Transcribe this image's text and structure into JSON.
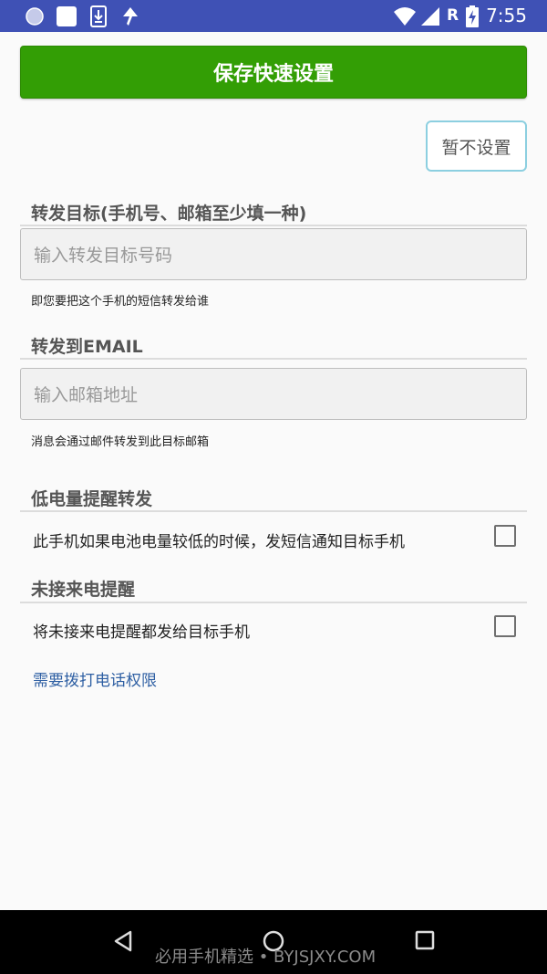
{
  "status_bar": {
    "time": "7:55",
    "network_letter": "R",
    "icons": [
      "circle-icon",
      "square-icon",
      "download-icon",
      "sync-icon",
      "wifi-icon",
      "signal-icon",
      "battery-charging-icon"
    ]
  },
  "actions": {
    "save_label": "保存快速设置",
    "skip_label": "暂不设置"
  },
  "forward_target": {
    "title": "转发目标(手机号、邮箱至少填一种)",
    "phone_placeholder": "输入转发目标号码",
    "phone_value": "",
    "phone_hint": "即您要把这个手机的短信转发给谁"
  },
  "email": {
    "title": "转发到EMAIL",
    "placeholder": "输入邮箱地址",
    "value": "",
    "hint": "消息会通过邮件转发到此目标邮箱"
  },
  "low_battery": {
    "title": "低电量提醒转发",
    "option_label": "此手机如果电池电量较低的时候，发短信通知目标手机",
    "checked": false
  },
  "missed_call": {
    "title": "未接来电提醒",
    "option_label": "将未接来电提醒都发给目标手机",
    "checked": false,
    "permission_link": "需要拨打电话权限"
  },
  "nav_bar": {
    "icons": [
      "back-icon",
      "home-icon",
      "recents-icon"
    ]
  },
  "watermark": "必用手机精选 • BYJSJXY.COM",
  "colors": {
    "status_bar": "#3f51b5",
    "save_button": "#339e05",
    "skip_button_border": "#8ccfe0",
    "link": "#2e5fa3"
  }
}
